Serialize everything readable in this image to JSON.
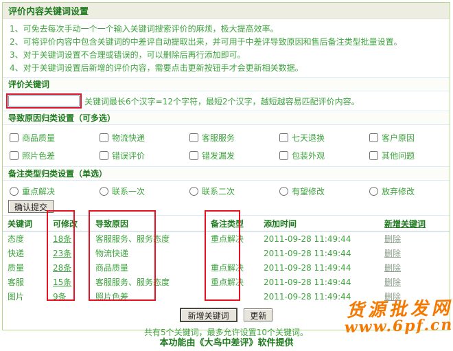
{
  "page": {
    "title": "评价内容关键词设置",
    "instructions": [
      "1、可免去每次手动一个一个输入关键词搜索评价的麻烦，极大提高效率。",
      "2、可将评价内容中包含关键词的中差评自动提取出来，并可用于中差评导致原因和售后备注类型批量设置。",
      "3、对于关键词设置不合理或错误的，可以删除后再行添加即可。",
      "4、对于关键词设置后新增的评价内容，需要点击更新按钮手才会更新相关数据。"
    ]
  },
  "keyword_section": {
    "header": "评价关键词",
    "input_value": "",
    "hint": "关键词最长6个汉字=12个字符，最短2个汉字，越短越容易匹配评价内容。"
  },
  "reason_section": {
    "header": "导致原因归类设置（可多选）",
    "options_row1": [
      "商品质量",
      "物流快递",
      "客服服务",
      "七天退换",
      "客户原因"
    ],
    "options_row2": [
      "照片色差",
      "错误评价",
      "错发漏发",
      "包装外观",
      "其他问题"
    ]
  },
  "note_section": {
    "header": "备注类型归类设置（单选）",
    "options": [
      "重点解决",
      "联系一次",
      "联系二次",
      "有望修改",
      "放弃修改"
    ]
  },
  "submit_button": "确认提交",
  "table": {
    "headers": {
      "keyword": "关键词",
      "count": "可修改",
      "reason": "导致原因",
      "note": "备注类型",
      "time": "添加时间",
      "action": "新增关键词"
    },
    "rows": [
      {
        "keyword": "态度",
        "count": "18条",
        "reason": "客服服务、服务态度",
        "note": "重点解决",
        "time": "2011-09-28 11:49:44",
        "action": "删除"
      },
      {
        "keyword": "快递",
        "count": "23条",
        "reason": "物流快递",
        "note": "",
        "time": "2011-09-28 11:49:44",
        "action": "删除"
      },
      {
        "keyword": "质量",
        "count": "28条",
        "reason": "商品质量",
        "note": "重点解决",
        "time": "2011-09-28 11:49:44",
        "action": "删除"
      },
      {
        "keyword": "客服",
        "count": "15条",
        "reason": "客服服务、服务态度",
        "note": "重点解决",
        "time": "2011-09-28 11:49:44",
        "action": "删除"
      },
      {
        "keyword": "图片",
        "count": "9条",
        "reason": "照片色差",
        "note": "",
        "time": "2011-09-28 11:49:44",
        "action": "删除"
      }
    ]
  },
  "bottom_buttons": {
    "add": "新增关键词",
    "update": "更新"
  },
  "summary": "共有5个关键词，最多允许设置10个关键词。",
  "footer": "本功能由《大鸟中差评》软件提供",
  "watermark": {
    "line1": "货源批发网",
    "line2": "www.6pf.cn"
  },
  "colors": {
    "header_green": "#1f7a1f",
    "body_green": "#3fa33f",
    "annotation_red": "#e81123",
    "watermark_orange": "#f57900",
    "delete_link_gray": "#8b9e8b",
    "container_border_green": "#b6d78e",
    "titlebar_beige": "#eeede1"
  }
}
